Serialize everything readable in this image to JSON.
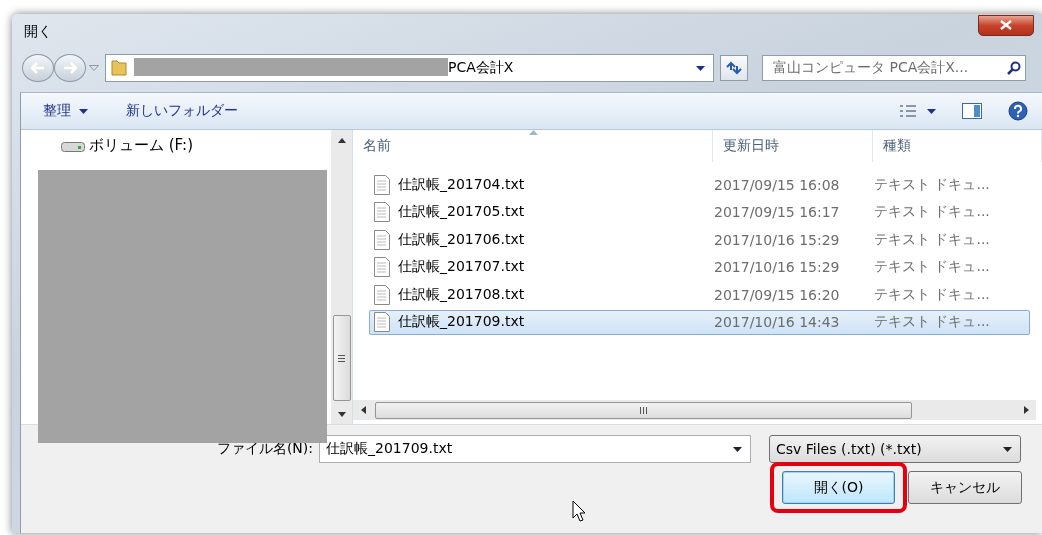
{
  "window": {
    "title": "開く"
  },
  "address": {
    "path": "PCA会計X"
  },
  "search": {
    "placeholder": "富山コンピュータ PCA会計X..."
  },
  "toolbar": {
    "organize": "整理",
    "new_folder": "新しいフォルダー"
  },
  "nav": {
    "items": [
      {
        "label": "ボリューム (F:)"
      }
    ]
  },
  "columns": [
    {
      "label": "名前",
      "sorted": true
    },
    {
      "label": "更新日時",
      "sorted": false
    },
    {
      "label": "種類",
      "sorted": false
    }
  ],
  "files": [
    {
      "name": "仕訳帳_201704.txt",
      "modified": "2017/09/15 16:08",
      "type": "テキスト ドキュ...",
      "selected": false
    },
    {
      "name": "仕訳帳_201705.txt",
      "modified": "2017/09/15 16:17",
      "type": "テキスト ドキュ...",
      "selected": false
    },
    {
      "name": "仕訳帳_201706.txt",
      "modified": "2017/10/16 15:29",
      "type": "テキスト ドキュ...",
      "selected": false
    },
    {
      "name": "仕訳帳_201707.txt",
      "modified": "2017/10/16 15:29",
      "type": "テキスト ドキュ...",
      "selected": false
    },
    {
      "name": "仕訳帳_201708.txt",
      "modified": "2017/09/15 16:20",
      "type": "テキスト ドキュ...",
      "selected": false
    },
    {
      "name": "仕訳帳_201709.txt",
      "modified": "2017/10/16 14:43",
      "type": "テキスト ドキュ...",
      "selected": true
    }
  ],
  "filename": {
    "label": "ファイル名(N):",
    "value": "仕訳帳_201709.txt"
  },
  "filter": {
    "value": "Csv Files (.txt) (*.txt)"
  },
  "buttons": [
    {
      "label": "開く(O)",
      "highlighted": true,
      "default": true
    },
    {
      "label": "キャンセル",
      "highlighted": false,
      "default": false
    }
  ]
}
